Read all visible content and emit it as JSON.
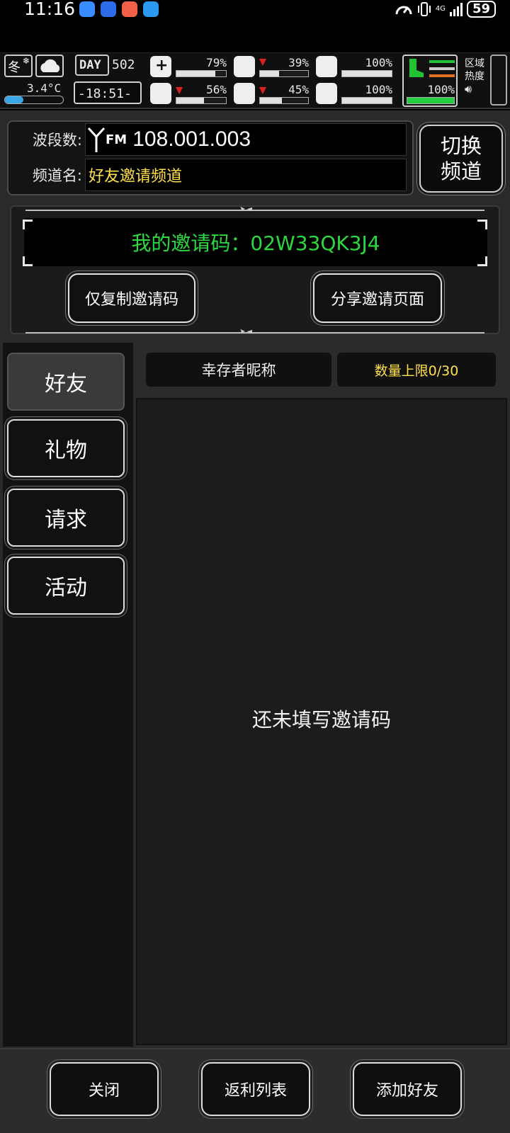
{
  "status_bar": {
    "time": "11:16",
    "network": "4G",
    "battery": "59"
  },
  "hud": {
    "season": "冬",
    "temperature": "3.4°C",
    "day_label": "DAY",
    "day_number": "502",
    "clock": "-18:51-",
    "health_pct": "79%",
    "hunger_pct": "39%",
    "sanity_pct": "56%",
    "thirst_pct": "45%",
    "stat3_pct": "100%",
    "mood_pct": "100%",
    "stamina_pct": "100%",
    "region_heat_line1": "区域",
    "region_heat_line2": "热度",
    "bars": {
      "health": 0.79,
      "hunger": 0.39,
      "sanity": 0.56,
      "thirst": 0.45,
      "stat3": 1.0,
      "mood": 1.0,
      "stamina": 1.0
    }
  },
  "channel": {
    "band_label": "波段数:",
    "band_value": "108.001.003",
    "fm_label": "FM",
    "name_label": "频道名:",
    "name_value": "好友邀请频道",
    "switch_line1": "切换",
    "switch_line2": "频道"
  },
  "invite": {
    "code_text": "我的邀请码：02W33QK3J4",
    "copy_button": "仅复制邀请码",
    "share_button": "分享邀请页面"
  },
  "tabs": [
    {
      "label": "好友"
    },
    {
      "label": "礼物"
    },
    {
      "label": "请求"
    },
    {
      "label": "活动"
    }
  ],
  "friends": {
    "col_nickname": "幸存者昵称",
    "col_limit": "数量上限0/30",
    "empty_message": "还未填写邀请码"
  },
  "bottom": {
    "close": "关闭",
    "rebate_list": "返利列表",
    "add_friend": "添加好友"
  },
  "colors": {
    "accent_green": "#2bd93e",
    "accent_yellow": "#ffe24a",
    "warning_red": "#e02020"
  }
}
